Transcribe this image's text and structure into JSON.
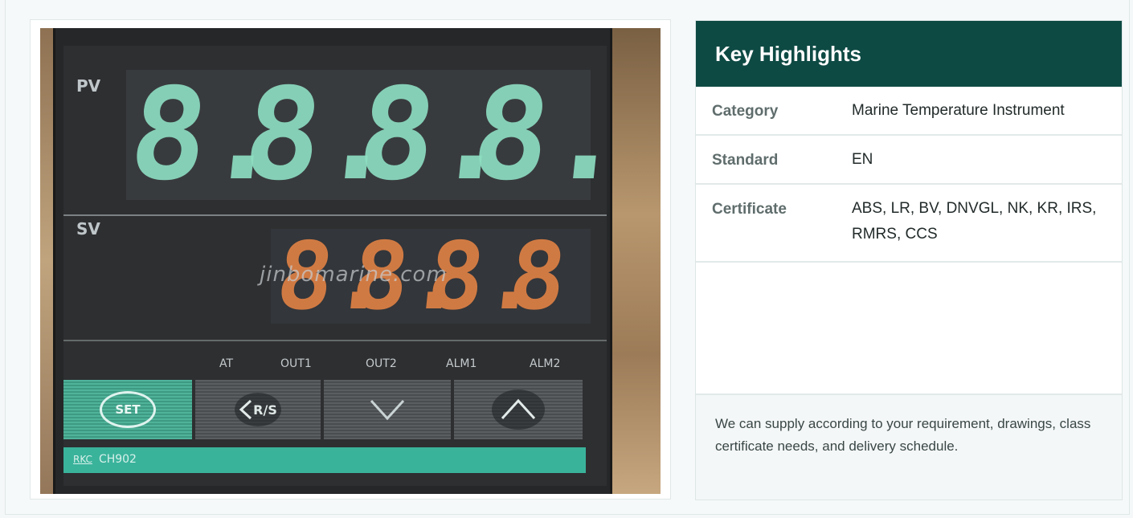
{
  "photo": {
    "pv_label": "PV",
    "sv_label": "SV",
    "pv_digits": [
      "8.",
      "8.",
      "8.",
      "8."
    ],
    "sv_digits": [
      "8.",
      "8.",
      "8.",
      "8"
    ],
    "watermark": "jinbomarine.com",
    "indicators": [
      "AT",
      "OUT1",
      "OUT2",
      "ALM1",
      "ALM2"
    ],
    "keys": {
      "set": "SET",
      "rs": "R/S",
      "down": "chevron-down-icon",
      "up": "chevron-up-icon"
    },
    "brand": "RKC",
    "model": "CH902",
    "colors": {
      "pv": "#8ee0c3",
      "sv": "#d07a43",
      "accent": "#3ab39b"
    }
  },
  "highlights": {
    "title": "Key Highlights",
    "rows": [
      {
        "label": "Category",
        "value": "Marine Temperature Instrument"
      },
      {
        "label": "Standard",
        "value": "EN"
      },
      {
        "label": "Certificate",
        "value": "ABS, LR, BV, DNVGL, NK, KR, IRS, RMRS, CCS"
      }
    ],
    "note": "We can supply according to your requirement, drawings, class certificate needs, and delivery schedule.",
    "header_color": "#0e4a44"
  }
}
